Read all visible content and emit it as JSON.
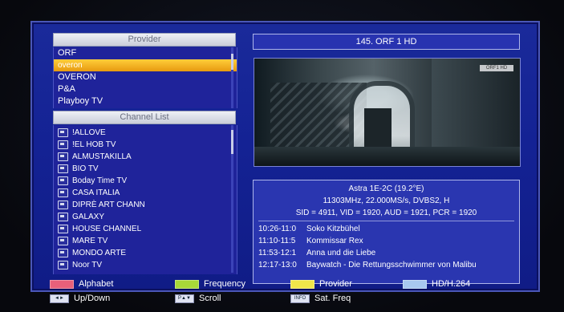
{
  "provider_panel": {
    "header": "Provider",
    "items": [
      {
        "label": "ORF",
        "selected": false
      },
      {
        "label": "overon",
        "selected": true
      },
      {
        "label": "OVERON",
        "selected": false
      },
      {
        "label": "P&A",
        "selected": false
      },
      {
        "label": "Playboy TV",
        "selected": false
      }
    ]
  },
  "channel_panel": {
    "header": "Channel List",
    "items": [
      "!ALLOVE",
      "!EL HOB TV",
      "ALMUSTAKILLA",
      "BIO TV",
      "Boday Time TV",
      "CASA ITALIA",
      "DIPRÈ ART CHANN",
      "GALAXY",
      "HOUSE CHANNEL",
      "MARE TV",
      "MONDO ARTE",
      "Noor TV"
    ]
  },
  "current_channel": {
    "title": "145. ORF 1 HD"
  },
  "video_preview": {
    "badge": "ORF1 HD"
  },
  "info_box": {
    "satellite": "Astra 1E-2C (19.2°E)",
    "transponder": "11303MHz, 22.000MS/s, DVBS2, H",
    "pids": "SID = 4911, VID = 1920, AUD = 1921, PCR = 1920",
    "epg": [
      {
        "time": "10:26-11:0",
        "title": "Soko Kitzbühel"
      },
      {
        "time": "11:10-11:5",
        "title": "Kommissar Rex"
      },
      {
        "time": "11:53-12:1",
        "title": "Anna und die Liebe"
      },
      {
        "time": "12:17-13:0",
        "title": "Baywatch - Die Rettungsschwimmer von Malibu"
      }
    ]
  },
  "legend": {
    "color_keys": [
      {
        "label": "Alphabet",
        "color": "#e8607a"
      },
      {
        "label": "Frequency",
        "color": "#a8d838"
      },
      {
        "label": "Provider",
        "color": "#f0e64a"
      },
      {
        "label": "HD/H.264",
        "color": "#a8c8f0"
      }
    ],
    "nav_keys": [
      {
        "key": "◄►",
        "label": "Up/Down"
      },
      {
        "key": "P▲▼",
        "label": "Scroll"
      },
      {
        "key": "INFO",
        "label": "Sat. Freq"
      }
    ]
  }
}
